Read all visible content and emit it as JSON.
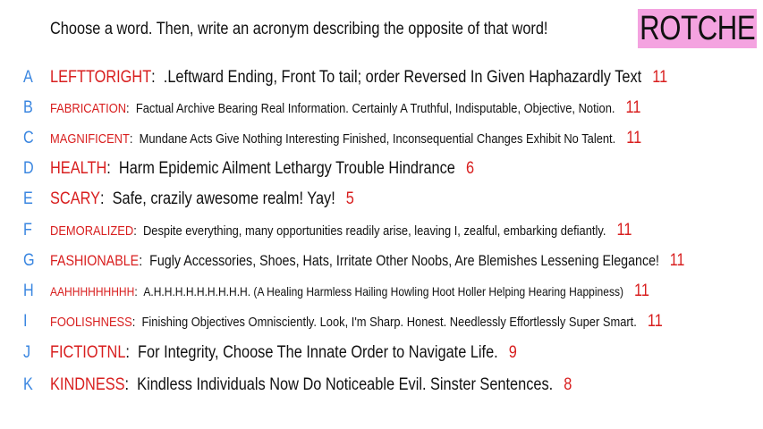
{
  "prompt": "Choose a word. Then, write an acronym describing the opposite of that word!",
  "badge": "ROTCHE",
  "rows": [
    {
      "letter": "A",
      "word": "LEFTTORIGHT",
      "acronym": ".Leftward Ending, Front To tail; order Reversed In Given Haphazardly Text",
      "count": "11"
    },
    {
      "letter": "B",
      "word": "FABRICATION",
      "acronym": "Factual Archive Bearing Real Information. Certainly A Truthful, Indisputable, Objective, Notion.",
      "count": "11"
    },
    {
      "letter": "C",
      "word": "MAGNIFICENT",
      "acronym": "Mundane Acts Give Nothing Interesting Finished, Inconsequential Changes Exhibit No Talent.",
      "count": "11"
    },
    {
      "letter": "D",
      "word": "HEALTH",
      "acronym": "Harm Epidemic Ailment Lethargy Trouble Hindrance",
      "count": "6"
    },
    {
      "letter": "E",
      "word": "SCARY",
      "acronym": "Safe, crazily awesome realm! Yay!",
      "count": "5"
    },
    {
      "letter": "F",
      "word": "DEMORALIZED",
      "acronym": "Despite everything, many opportunities readily arise, leaving I, zealful, embarking defiantly.",
      "count": "11"
    },
    {
      "letter": "G",
      "word": "FASHIONABLE",
      "acronym": "Fugly Accessories, Shoes, Hats, Irritate Other Noobs, Are Blemishes Lessening Elegance!",
      "count": "11"
    },
    {
      "letter": "H",
      "word": "AAHHHHHHHHH",
      "acronym": "A.H.H.H.H.H.H.H.H.H. (A Healing Harmless Hailing Howling Hoot Holler Helping Hearing Happiness)",
      "count": "11"
    },
    {
      "letter": "I",
      "word": "FOOLISHNESS",
      "acronym": "Finishing Objectives Omnisciently. Look, I'm Sharp. Honest. Needlessly Effortlessly Super Smart.",
      "count": "11"
    },
    {
      "letter": "J",
      "word": "FICTIOTNL",
      "acronym": "For Integrity, Choose The Innate Order to Navigate Life.",
      "count": "9"
    },
    {
      "letter": "K",
      "word": "KINDNESS",
      "acronym": "Kindless Individuals Now Do Noticeable Evil. Sinster Sentences.",
      "count": "8"
    }
  ]
}
